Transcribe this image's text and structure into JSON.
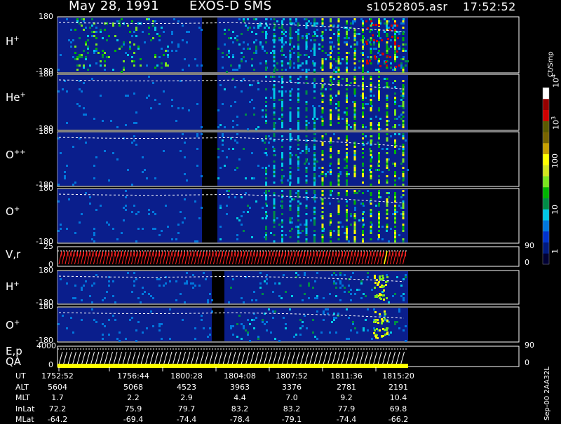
{
  "header": {
    "date": "May 28, 1991",
    "instrument": "EXOS-D SMS",
    "file": "s1052805.asr",
    "time": "17:52:52"
  },
  "colorbar": {
    "unit": "Ct/Smp",
    "ticks": [
      "1",
      "10",
      "100",
      "10",
      "10"
    ],
    "tick_exps": [
      "",
      "",
      "",
      "3",
      "4"
    ],
    "colors": [
      "#000033",
      "#001a80",
      "#0033cc",
      "#0077dd",
      "#00c8e6",
      "#008c46",
      "#00b400",
      "#7ae61e",
      "#d2e61e",
      "#ffff00",
      "#c8a000",
      "#786400",
      "#5a5a00",
      "#d20000",
      "#960000",
      "#ffffff"
    ]
  },
  "sidebar_label": "Sep-00 2AA32L",
  "panels": [
    {
      "label": "H",
      "sup": "+",
      "ymax": "180",
      "ymin": "-180"
    },
    {
      "label": "He",
      "sup": "+",
      "ymax": "180",
      "ymin": "-180"
    },
    {
      "label": "O",
      "sup": "++",
      "ymax": "180",
      "ymin": "-180"
    },
    {
      "label": "O",
      "sup": "+",
      "ymax": "180",
      "ymin": "-180"
    },
    {
      "label": "V,r",
      "sup": "",
      "ymax": "25",
      "ymin": "0",
      "right_max": "90",
      "right_min": "0"
    },
    {
      "label": "H",
      "sup": "+",
      "ymax": "180",
      "ymin": "-180"
    },
    {
      "label": "O",
      "sup": "+",
      "ymax": "180",
      "ymin": "-180"
    },
    {
      "label": "E,p",
      "sup": "",
      "ymax": "4000",
      "ymin": "0",
      "right_max": "90",
      "right_min": "0"
    }
  ],
  "qa_label": "QA",
  "orbit": {
    "row_labels": [
      "UT",
      "ALT",
      "MLT",
      "InLat",
      "MLat"
    ],
    "columns": [
      [
        "1752:52",
        "5604",
        "1.7",
        "72.2",
        "-64.2"
      ],
      [
        "1756:44",
        "5068",
        "2.2",
        "75.9",
        "-69.4"
      ],
      [
        "1800:28",
        "4523",
        "2.9",
        "79.7",
        "-74.4"
      ],
      [
        "1804:08",
        "3963",
        "4.4",
        "83.2",
        "-78.4"
      ],
      [
        "1807:52",
        "3376",
        "7.0",
        "83.2",
        "-79.1"
      ],
      [
        "1811:36",
        "2781",
        "9.2",
        "77.9",
        "-74.4"
      ],
      [
        "1815:20",
        "2191",
        "10.4",
        "69.8",
        "-66.2"
      ]
    ]
  },
  "chart_data": {
    "type": "heatmap",
    "title": "May 28, 1991   EXOS-D SMS",
    "x_ticks": [
      "1752:52",
      "1756:44",
      "1800:28",
      "1804:08",
      "1807:52",
      "1811:36",
      "1815:20"
    ],
    "panels": [
      "H+",
      "He+",
      "O++",
      "O+",
      "V,r",
      "H+",
      "O+",
      "E,p"
    ],
    "pitch_range": [
      -180,
      180
    ],
    "colorbar_range": [
      1,
      10000
    ],
    "colorbar_scale": "log",
    "colorbar_unit": "Ct/Smp"
  }
}
